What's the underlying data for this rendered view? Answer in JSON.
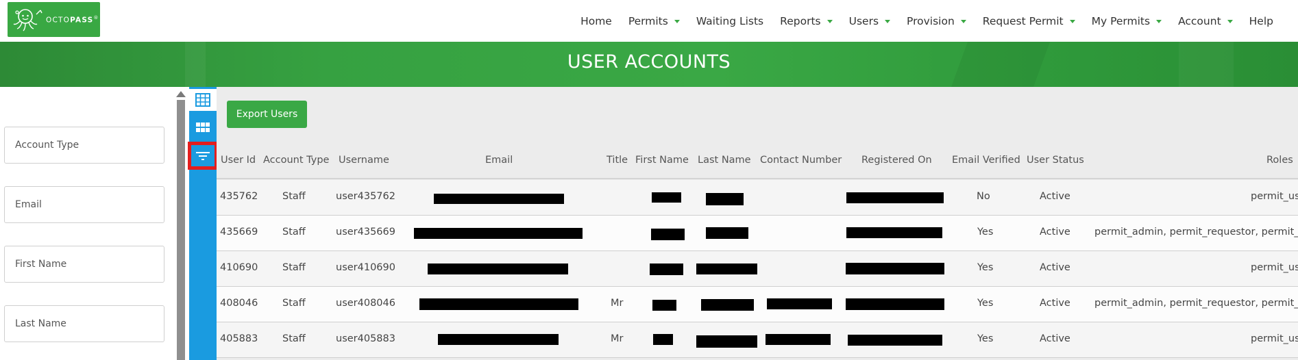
{
  "logo": {
    "text_light": "OCTO",
    "text_bold": "PASS",
    "mark": "®"
  },
  "nav": [
    {
      "label": "Home",
      "dropdown": false
    },
    {
      "label": "Permits",
      "dropdown": true
    },
    {
      "label": "Waiting Lists",
      "dropdown": false
    },
    {
      "label": "Reports",
      "dropdown": true
    },
    {
      "label": "Users",
      "dropdown": true
    },
    {
      "label": "Provision",
      "dropdown": true
    },
    {
      "label": "Request Permit",
      "dropdown": true
    },
    {
      "label": "My Permits",
      "dropdown": true
    },
    {
      "label": "Account",
      "dropdown": true
    },
    {
      "label": "Help",
      "dropdown": false
    }
  ],
  "banner": {
    "title": "USER ACCOUNTS"
  },
  "filters": [
    {
      "placeholder": "Account Type"
    },
    {
      "placeholder": "Email"
    },
    {
      "placeholder": "First Name"
    },
    {
      "placeholder": "Last Name"
    }
  ],
  "toolbar": {
    "icons": [
      "grid-icon",
      "columns-icon",
      "filter-icon"
    ],
    "export_label": "Export Users"
  },
  "table": {
    "columns": [
      "User Id",
      "Account Type",
      "Username",
      "Email",
      "Title",
      "First Name",
      "Last Name",
      "Contact Number",
      "Registered On",
      "Email Verified",
      "User Status",
      "Roles"
    ],
    "rows": [
      {
        "user_id": "435762",
        "account_type": "Staff",
        "username": "user435762",
        "title": "",
        "email_verified": "No",
        "user_status": "Active",
        "roles": "permit_us"
      },
      {
        "user_id": "435669",
        "account_type": "Staff",
        "username": "user435669",
        "title": "",
        "email_verified": "Yes",
        "user_status": "Active",
        "roles": "permit_admin, permit_requestor, permit_us"
      },
      {
        "user_id": "410690",
        "account_type": "Staff",
        "username": "user410690",
        "title": "",
        "email_verified": "Yes",
        "user_status": "Active",
        "roles": "permit_us"
      },
      {
        "user_id": "408046",
        "account_type": "Staff",
        "username": "user408046",
        "title": "Mr",
        "email_verified": "Yes",
        "user_status": "Active",
        "roles": "permit_admin, permit_requestor, permit_us"
      },
      {
        "user_id": "405883",
        "account_type": "Staff",
        "username": "user405883",
        "title": "Mr",
        "email_verified": "Yes",
        "user_status": "Active",
        "roles": "permit_us"
      }
    ]
  },
  "colors": {
    "brand_green": "#3aa845",
    "tool_blue": "#1a9be0",
    "highlight_red": "#e41d1d"
  }
}
